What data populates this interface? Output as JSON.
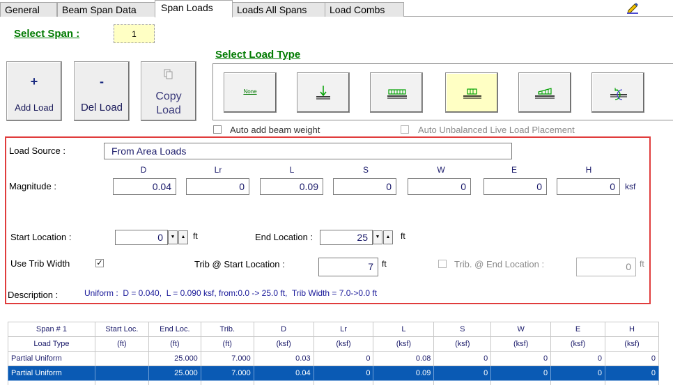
{
  "tabs": [
    {
      "label": "General",
      "active": false
    },
    {
      "label": "Beam Span Data",
      "active": false
    },
    {
      "label": "Span Loads",
      "active": true
    },
    {
      "label": "Loads All Spans",
      "active": false
    },
    {
      "label": "Load Combs",
      "active": false
    }
  ],
  "select_span": {
    "label": "Select Span :",
    "value": "1"
  },
  "buttons": {
    "add": {
      "symbol": "+",
      "label": "Add Load"
    },
    "del": {
      "symbol": "-",
      "label": "Del Load"
    },
    "copy": {
      "line1": "Copy",
      "line2": "Load"
    }
  },
  "load_type": {
    "label": "Select Load Type",
    "none_label": "None",
    "icons": [
      "none-load-icon",
      "point-load-icon",
      "uniform-full-load-icon",
      "partial-uniform-load-icon",
      "trapezoidal-load-icon",
      "moment-load-icon"
    ],
    "selected_index": 3
  },
  "options": {
    "auto_beam_weight": {
      "label": "Auto add beam weight",
      "checked": false
    },
    "auto_unbalanced": {
      "label": "Auto Unbalanced Live Load Placement",
      "checked": false
    }
  },
  "load_source": {
    "label": "Load Source :",
    "value": "From Area Loads"
  },
  "magnitude": {
    "label": "Magnitude :",
    "unit": "ksf",
    "columns": [
      {
        "name": "D",
        "value": "0.04"
      },
      {
        "name": "Lr",
        "value": "0"
      },
      {
        "name": "L",
        "value": "0.09"
      },
      {
        "name": "S",
        "value": "0"
      },
      {
        "name": "W",
        "value": "0"
      },
      {
        "name": "E",
        "value": "0"
      },
      {
        "name": "H",
        "value": "0"
      }
    ]
  },
  "start_location": {
    "label": "Start Location :",
    "value": "0",
    "unit": "ft"
  },
  "end_location": {
    "label": "End Location :",
    "value": "25",
    "unit": "ft"
  },
  "trib": {
    "use_label": "Use Trib Width",
    "use_checked": "✓",
    "start_label": "Trib @ Start Location :",
    "start_value": "7",
    "start_unit": "ft",
    "end_label": "Trib. @ End Location :",
    "end_value": "0",
    "end_unit": "ft"
  },
  "description": {
    "label": "Description :",
    "value": "Uniform :  D = 0.040,  L = 0.090 ksf, from:0.0 -> 25.0 ft,  Trib Width = 7.0->0.0 ft"
  },
  "table": {
    "header1": [
      "Span # 1",
      "Start Loc.",
      "End Loc.",
      "Trib.",
      "D",
      "Lr",
      "L",
      "S",
      "W",
      "E",
      "H"
    ],
    "header2": [
      "Load Type",
      "(ft)",
      "(ft)",
      "(ft)",
      "(ksf)",
      "(ksf)",
      "(ksf)",
      "(ksf)",
      "(ksf)",
      "(ksf)",
      "(ksf)"
    ],
    "rows": [
      [
        "Partial Uniform",
        "",
        "25.000",
        "7.000",
        "0.03",
        "0",
        "0.08",
        "0",
        "0",
        "0",
        "0"
      ],
      [
        "Partial Uniform",
        "",
        "25.000",
        "7.000",
        "0.04",
        "0",
        "0.09",
        "0",
        "0",
        "0",
        "0"
      ]
    ],
    "selected_row": 1
  },
  "colors": {
    "accent_green": "#007a00",
    "highlight_yellow": "#ffffc4",
    "frame_red": "#e03c3c",
    "selection_blue": "#0a5ab4"
  }
}
